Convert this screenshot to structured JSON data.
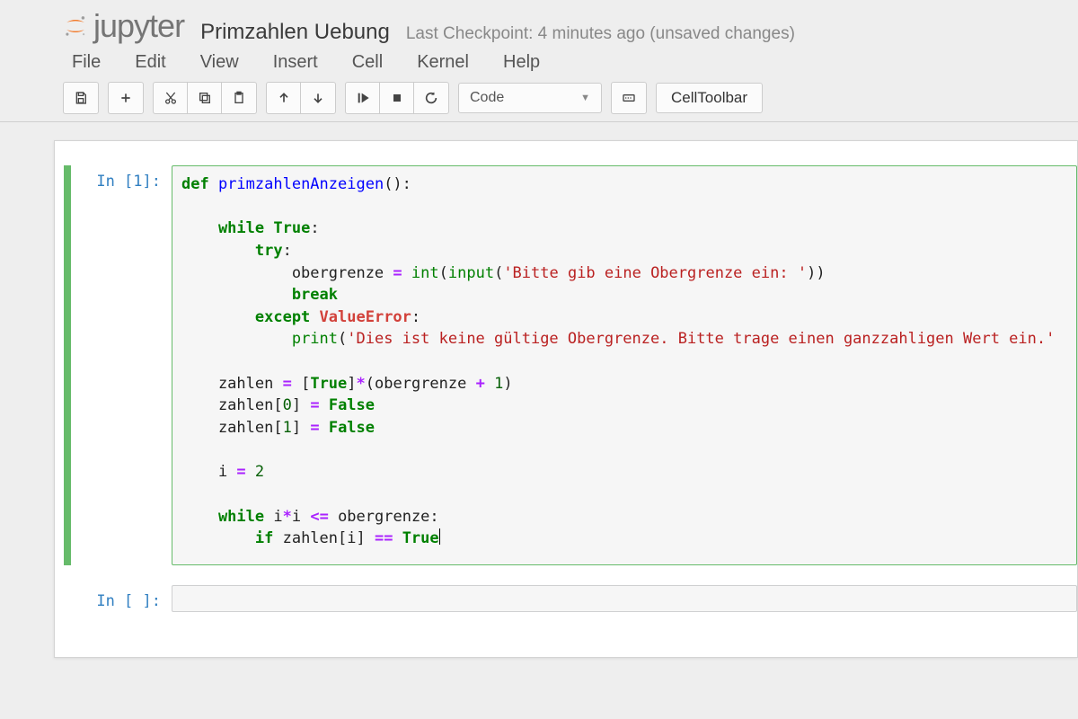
{
  "brand": "jupyter",
  "title": "Primzahlen Uebung",
  "checkpoint": "Last Checkpoint: 4 minutes ago (unsaved changes)",
  "menu": {
    "file": "File",
    "edit": "Edit",
    "view": "View",
    "insert": "Insert",
    "cell": "Cell",
    "kernel": "Kernel",
    "help": "Help"
  },
  "toolbar": {
    "cell_type": "Code",
    "celltoolbar": "CellToolbar"
  },
  "cells": {
    "c1_prompt": "In [1]:",
    "c2_prompt": "In [ ]:",
    "code": {
      "l1_def": "def",
      "l1_name": " primzahlenAnzeigen",
      "l1_paren": "():",
      "l2": "",
      "l3_while": "    while",
      "l3_true": " True",
      "l3_colon": ":",
      "l4_try": "        try",
      "l4_colon": ":",
      "l5_ind": "            obergrenze ",
      "l5_eq": "=",
      "l5_sp": " ",
      "l5_int": "int",
      "l5_open": "(",
      "l5_input": "input",
      "l5_open2": "(",
      "l5_str": "'Bitte gib eine Obergrenze ein: '",
      "l5_close": "))",
      "l6_break": "            break",
      "l7_except": "        except",
      "l7_sp": " ",
      "l7_exc": "ValueError",
      "l7_colon": ":",
      "l8_ind": "            ",
      "l8_print": "print",
      "l8_open": "(",
      "l8_str": "'Dies ist keine gültige Obergrenze. Bitte trage einen ganzzahligen Wert ein.'",
      "l9": "",
      "l10_a": "    zahlen ",
      "l10_eq": "=",
      "l10_b": " [",
      "l10_true": "True",
      "l10_c": "]",
      "l10_mul": "*",
      "l10_d": "(obergrenze ",
      "l10_plus": "+",
      "l10_e": " ",
      "l10_one": "1",
      "l10_f": ")",
      "l11_a": "    zahlen[",
      "l11_zero": "0",
      "l11_b": "] ",
      "l11_eq": "=",
      "l11_sp": " ",
      "l11_false": "False",
      "l12_a": "    zahlen[",
      "l12_one": "1",
      "l12_b": "] ",
      "l12_eq": "=",
      "l12_sp": " ",
      "l12_false": "False",
      "l13": "",
      "l14_a": "    i ",
      "l14_eq": "=",
      "l14_sp": " ",
      "l14_two": "2",
      "l15": "",
      "l16_while": "    while",
      "l16_a": " i",
      "l16_mul": "*",
      "l16_b": "i ",
      "l16_le": "<=",
      "l16_c": " obergrenze:",
      "l17_if": "        if",
      "l17_a": " zahlen[i] ",
      "l17_eqeq": "==",
      "l17_sp": " ",
      "l17_true": "True"
    }
  }
}
